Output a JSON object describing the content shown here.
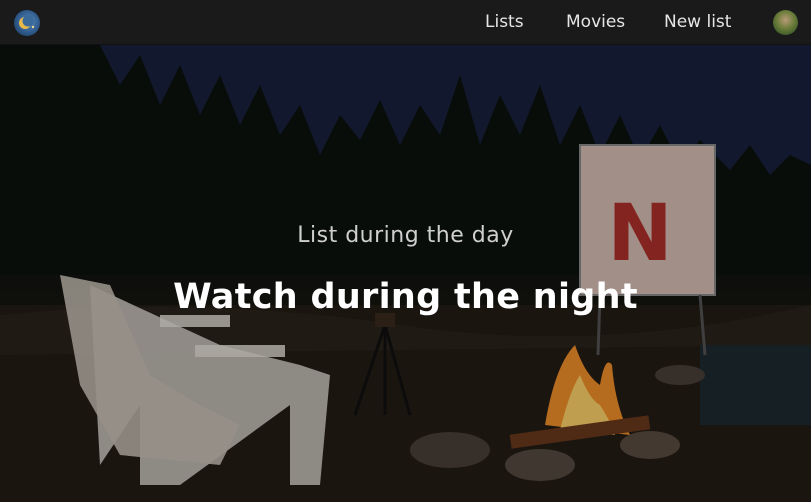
{
  "nav": {
    "logo_icon": "moon-icon",
    "links": [
      {
        "label": "Lists"
      },
      {
        "label": "Movies"
      },
      {
        "label": "New list"
      }
    ],
    "avatar_icon": "user-avatar"
  },
  "hero": {
    "subtitle": "List during the day",
    "title": "Watch during the night",
    "screen_logo": "N"
  }
}
